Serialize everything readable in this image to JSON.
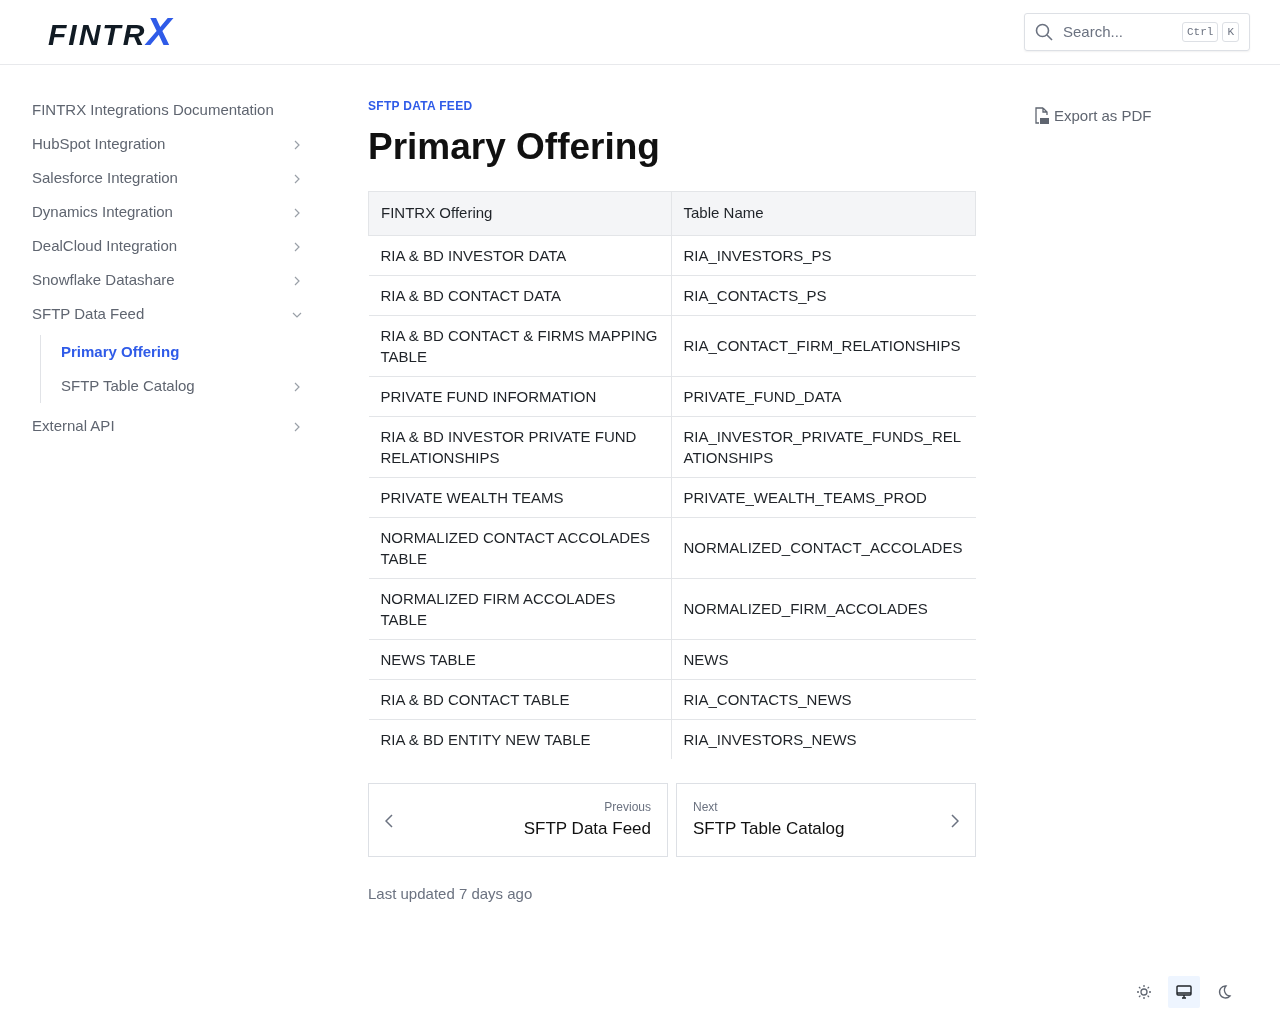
{
  "header": {
    "logo": {
      "text": "FINTR",
      "accent": "X"
    },
    "search": {
      "placeholder": "Search...",
      "keys": [
        "Ctrl",
        "K"
      ]
    }
  },
  "sidebar": {
    "items": [
      {
        "label": "FINTRX Integrations Documentation",
        "selected": false
      },
      {
        "label": "HubSpot Integration",
        "selected": false,
        "expanded": false
      },
      {
        "label": "Salesforce Integration",
        "selected": false,
        "expanded": false
      },
      {
        "label": "Dynamics Integration",
        "selected": false,
        "expanded": false
      },
      {
        "label": "DealCloud Integration",
        "selected": false,
        "expanded": false
      },
      {
        "label": "Snowflake Datashare",
        "selected": false,
        "expanded": false
      },
      {
        "label": "SFTP Data Feed",
        "selected": false,
        "expanded": true,
        "children": [
          {
            "label": "Primary Offering",
            "selected": true
          },
          {
            "label": "SFTP Table Catalog",
            "selected": false,
            "expanded": false
          }
        ]
      },
      {
        "label": "External API",
        "selected": false,
        "expanded": false
      }
    ]
  },
  "page": {
    "breadcrumb": "SFTP DATA FEED",
    "title": "Primary Offering",
    "table": {
      "columns": [
        "FINTRX Offering",
        "Table Name"
      ],
      "rows": [
        [
          "RIA & BD INVESTOR DATA",
          "RIA_INVESTORS_PS"
        ],
        [
          "RIA & BD CONTACT DATA",
          "RIA_CONTACTS_PS"
        ],
        [
          "RIA & BD CONTACT & FIRMS MAPPING TABLE",
          "RIA_CONTACT_FIRM_RELATIONSHIPS"
        ],
        [
          "PRIVATE FUND INFORMATION",
          "PRIVATE_FUND_DATA"
        ],
        [
          "RIA & BD INVESTOR PRIVATE FUND RELATIONSHIPS",
          "RIA_INVESTOR_PRIVATE_FUNDS_RELATIONSHIPS"
        ],
        [
          "PRIVATE WEALTH TEAMS",
          "PRIVATE_WEALTH_TEAMS_PROD"
        ],
        [
          "NORMALIZED CONTACT ACCOLADES TABLE",
          "NORMALIZED_CONTACT_ACCOLADES"
        ],
        [
          "NORMALIZED FIRM ACCOLADES TABLE",
          "NORMALIZED_FIRM_ACCOLADES"
        ],
        [
          "NEWS TABLE",
          "NEWS"
        ],
        [
          "RIA & BD CONTACT TABLE",
          "RIA_CONTACTS_NEWS"
        ],
        [
          "RIA & BD ENTITY NEW TABLE",
          "RIA_INVESTORS_NEWS"
        ]
      ]
    },
    "pager": [
      {
        "kind": "previous",
        "caption": "Previous",
        "title": "SFTP Data Feed"
      },
      {
        "kind": "next",
        "caption": "Next",
        "title": "SFTP Table Catalog"
      }
    ],
    "last_updated": "Last updated 7 days ago"
  },
  "export": {
    "label": "Export as PDF"
  },
  "theme_switch": [
    {
      "kind": "light",
      "selected": false
    },
    {
      "kind": "system",
      "selected": true
    },
    {
      "kind": "dark",
      "selected": false
    }
  ]
}
